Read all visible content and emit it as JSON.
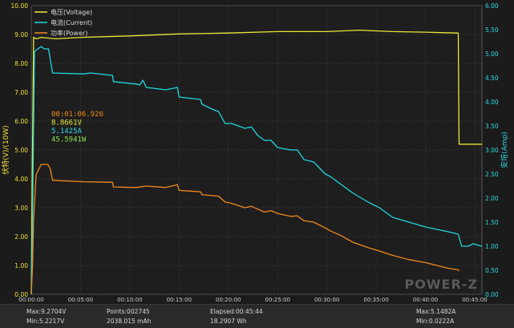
{
  "chart_data": {
    "type": "line",
    "xlabel": "",
    "ylabel_left": "伏特(V)/(10W)",
    "ylabel_right": "安培(Amp)",
    "xlim": [
      0,
      2744
    ],
    "ylim_left": [
      0,
      10
    ],
    "ylim_right": [
      0,
      6
    ],
    "x_ticks": [
      "00:00:00",
      "00:05:00",
      "00:10:00",
      "00:15:00",
      "00:20:00",
      "00:25:00",
      "00:30:00",
      "00:35:00",
      "00:40:00",
      "00:45:00"
    ],
    "y_ticks_left": [
      "0.00",
      "1.00",
      "2.00",
      "3.00",
      "4.00",
      "5.00",
      "6.00",
      "7.00",
      "8.00",
      "9.00",
      "10.00"
    ],
    "y_ticks_right": [
      "0.00",
      "0.50",
      "1.00",
      "1.50",
      "2.00",
      "2.50",
      "3.00",
      "3.50",
      "4.00",
      "4.50",
      "5.00",
      "5.50",
      "6.00"
    ],
    "grid": true,
    "legend_position": "top-left",
    "series": [
      {
        "name": "电压(Voltage)",
        "axis": "left",
        "color": "#e8e83a",
        "points": [
          [
            0,
            0
          ],
          [
            8,
            5.2
          ],
          [
            14,
            8.9
          ],
          [
            30,
            8.85
          ],
          [
            60,
            8.9
          ],
          [
            150,
            8.85
          ],
          [
            300,
            8.9
          ],
          [
            600,
            8.95
          ],
          [
            900,
            9.02
          ],
          [
            1200,
            9.05
          ],
          [
            1500,
            9.1
          ],
          [
            1800,
            9.1
          ],
          [
            2000,
            9.15
          ],
          [
            2200,
            9.1
          ],
          [
            2400,
            9.08
          ],
          [
            2520,
            9.06
          ],
          [
            2600,
            9.05
          ],
          [
            2605,
            5.2
          ],
          [
            2744,
            5.2
          ]
        ]
      },
      {
        "name": "电流(Current)",
        "axis": "right",
        "color": "#1fd6e0",
        "points": [
          [
            0,
            0
          ],
          [
            8,
            1.5
          ],
          [
            14,
            3.5
          ],
          [
            20,
            5.05
          ],
          [
            40,
            5.1
          ],
          [
            60,
            5.15
          ],
          [
            80,
            5.1
          ],
          [
            105,
            5.1
          ],
          [
            110,
            5.0
          ],
          [
            130,
            4.6
          ],
          [
            320,
            4.58
          ],
          [
            360,
            4.6
          ],
          [
            495,
            4.55
          ],
          [
            500,
            4.42
          ],
          [
            640,
            4.37
          ],
          [
            660,
            4.35
          ],
          [
            680,
            4.45
          ],
          [
            700,
            4.3
          ],
          [
            820,
            4.25
          ],
          [
            890,
            4.3
          ],
          [
            900,
            4.1
          ],
          [
            1030,
            4.05
          ],
          [
            1040,
            3.95
          ],
          [
            1100,
            3.85
          ],
          [
            1140,
            3.8
          ],
          [
            1180,
            3.55
          ],
          [
            1220,
            3.55
          ],
          [
            1300,
            3.45
          ],
          [
            1340,
            3.48
          ],
          [
            1380,
            3.3
          ],
          [
            1420,
            3.2
          ],
          [
            1460,
            3.2
          ],
          [
            1500,
            3.05
          ],
          [
            1580,
            3.0
          ],
          [
            1620,
            3.0
          ],
          [
            1660,
            2.8
          ],
          [
            1720,
            2.75
          ],
          [
            1790,
            2.5
          ],
          [
            1820,
            2.45
          ],
          [
            1880,
            2.3
          ],
          [
            1960,
            2.1
          ],
          [
            2060,
            1.9
          ],
          [
            2120,
            1.8
          ],
          [
            2200,
            1.6
          ],
          [
            2300,
            1.5
          ],
          [
            2400,
            1.4
          ],
          [
            2470,
            1.35
          ],
          [
            2540,
            1.3
          ],
          [
            2600,
            1.25
          ],
          [
            2620,
            1.0
          ],
          [
            2660,
            1.0
          ],
          [
            2690,
            1.05
          ],
          [
            2744,
            1.0
          ]
        ]
      },
      {
        "name": "功率(Power)",
        "axis": "left",
        "color": "#f08a1c",
        "points": [
          [
            0,
            0
          ],
          [
            8,
            1.0
          ],
          [
            14,
            2.6
          ],
          [
            30,
            4.15
          ],
          [
            60,
            4.5
          ],
          [
            100,
            4.5
          ],
          [
            115,
            4.35
          ],
          [
            130,
            3.95
          ],
          [
            320,
            3.9
          ],
          [
            495,
            3.88
          ],
          [
            500,
            3.72
          ],
          [
            640,
            3.7
          ],
          [
            700,
            3.75
          ],
          [
            820,
            3.7
          ],
          [
            890,
            3.8
          ],
          [
            900,
            3.6
          ],
          [
            1030,
            3.55
          ],
          [
            1040,
            3.45
          ],
          [
            1140,
            3.4
          ],
          [
            1180,
            3.2
          ],
          [
            1220,
            3.15
          ],
          [
            1300,
            3.0
          ],
          [
            1340,
            3.05
          ],
          [
            1380,
            2.95
          ],
          [
            1420,
            2.85
          ],
          [
            1460,
            2.9
          ],
          [
            1500,
            2.8
          ],
          [
            1580,
            2.7
          ],
          [
            1620,
            2.72
          ],
          [
            1660,
            2.55
          ],
          [
            1720,
            2.5
          ],
          [
            1790,
            2.3
          ],
          [
            1820,
            2.2
          ],
          [
            1880,
            2.05
          ],
          [
            1960,
            1.8
          ],
          [
            2060,
            1.6
          ],
          [
            2120,
            1.5
          ],
          [
            2200,
            1.35
          ],
          [
            2300,
            1.2
          ],
          [
            2400,
            1.1
          ],
          [
            2470,
            1.0
          ],
          [
            2540,
            0.9
          ],
          [
            2600,
            0.85
          ],
          [
            2605,
            0.8
          ]
        ]
      }
    ],
    "cursor_readout": {
      "time": "00:01:06.926",
      "voltage": "8.8661V",
      "current": "5.1425A",
      "power": "45.5941W"
    },
    "watermark": "POWER-Z",
    "stats": {
      "max_v": "Max:9.2704V",
      "min_v": "Min:5.2217V",
      "points": "Points:002745",
      "capacity_mah": "2038.015 mAh",
      "elapsed": "Elapsed:00:45:44",
      "energy": "18.2907 Wh",
      "max_a": "Max:5.1482A",
      "min_a": "Min:0.0222A"
    }
  }
}
